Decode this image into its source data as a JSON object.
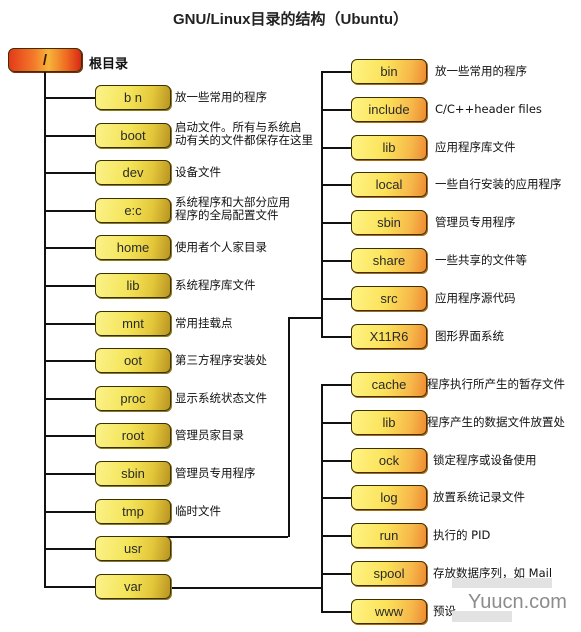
{
  "title": "GNU/Linux目录的结构（Ubuntu）",
  "root": {
    "name": "/",
    "desc": "根目录"
  },
  "left_dirs": [
    {
      "name": "bin",
      "shown": "b n",
      "desc": "放一些常用的程序"
    },
    {
      "name": "boot",
      "shown": "boot",
      "desc": "启动文件。所有与系统启\n动有关的文件都保存在这里"
    },
    {
      "name": "dev",
      "shown": "dev",
      "desc": "设备文件"
    },
    {
      "name": "etc",
      "shown": "e:c",
      "desc": "系统程序和大部分应用\n程序的全局配置文件"
    },
    {
      "name": "home",
      "shown": "home",
      "desc": "使用者个人家目录"
    },
    {
      "name": "lib",
      "shown": "lib",
      "desc": "系统程序库文件"
    },
    {
      "name": "mnt",
      "shown": "mnt",
      "desc": "常用挂载点"
    },
    {
      "name": "opt",
      "shown": "oot",
      "desc": "第三方程序安装处"
    },
    {
      "name": "proc",
      "shown": "proc",
      "desc": "显示系统状态文件"
    },
    {
      "name": "root",
      "shown": "root",
      "desc": "管理员家目录"
    },
    {
      "name": "sbin",
      "shown": "sbin",
      "desc": "管理员专用程序"
    },
    {
      "name": "tmp",
      "shown": "tmp",
      "desc": "临时文件"
    },
    {
      "name": "usr",
      "shown": "usr",
      "desc": ""
    },
    {
      "name": "var",
      "shown": "var",
      "desc": ""
    }
  ],
  "usr_dirs": [
    {
      "name": "bin",
      "desc": "放一些常用的程序"
    },
    {
      "name": "include",
      "desc": "C/C++header files"
    },
    {
      "name": "lib",
      "desc": "应用程序库文件"
    },
    {
      "name": "local",
      "desc": "一些自行安装的应用程序"
    },
    {
      "name": "sbin",
      "desc": "管理员专用程序"
    },
    {
      "name": "share",
      "desc": "一些共享的文件等"
    },
    {
      "name": "src",
      "desc": "应用程序源代码"
    },
    {
      "name": "X11R6",
      "desc": "图形界面系统"
    }
  ],
  "var_dirs": [
    {
      "name": "cache",
      "shown": "cache",
      "desc": "程序执行所产生的暂存文件"
    },
    {
      "name": "lib",
      "shown": "lib",
      "desc": "程序产生的数据文件放置处"
    },
    {
      "name": "lock",
      "shown": "ock",
      "desc": "锁定程序或设备使用"
    },
    {
      "name": "log",
      "shown": "log",
      "desc": "放置系统记录文件"
    },
    {
      "name": "run",
      "shown": "run",
      "desc": "执行的 PID"
    },
    {
      "name": "spool",
      "shown": "spool",
      "desc": "存放数据序列，如 Mail"
    },
    {
      "name": "www",
      "shown": "www",
      "desc": "预设"
    }
  ],
  "watermark": "Yuucn.com",
  "colors": {
    "root_box": "#e8461c",
    "left_box": "#f4e458",
    "right_box": "#fbe25a",
    "connector": "#111111"
  }
}
